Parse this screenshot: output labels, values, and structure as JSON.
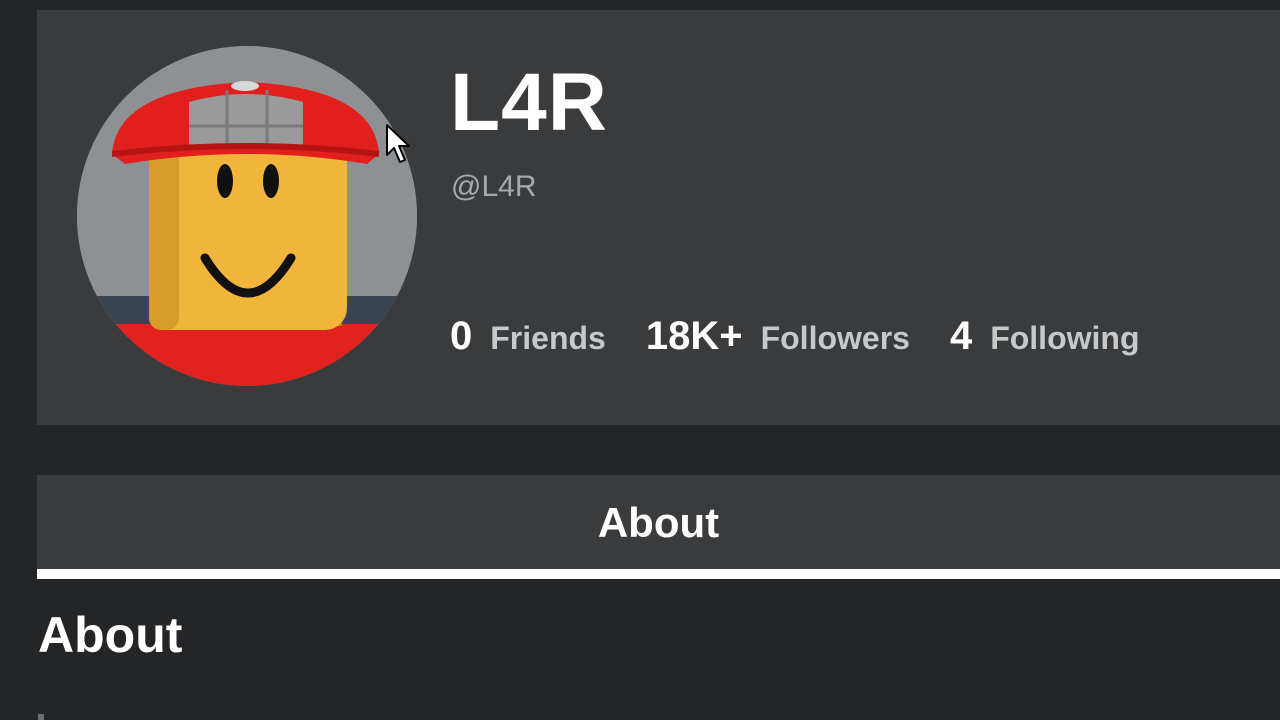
{
  "profile": {
    "display_name": "L4R",
    "username": "@L4R",
    "stats": [
      {
        "count": "0",
        "label": "Friends"
      },
      {
        "count": "18K+",
        "label": "Followers"
      },
      {
        "count": "4",
        "label": "Following"
      }
    ]
  },
  "tabs": [
    {
      "label": "About",
      "selected": true
    }
  ],
  "about": {
    "heading": "About"
  },
  "colors": {
    "page_bg": "#232527",
    "card_bg": "#393b3d",
    "text_primary": "#ffffff",
    "text_secondary": "#a8a9ab",
    "tab_indicator": "#ffffff"
  },
  "icons": {
    "avatar": "roblox-avatar-headshot",
    "cursor": "mouse-pointer-icon"
  }
}
